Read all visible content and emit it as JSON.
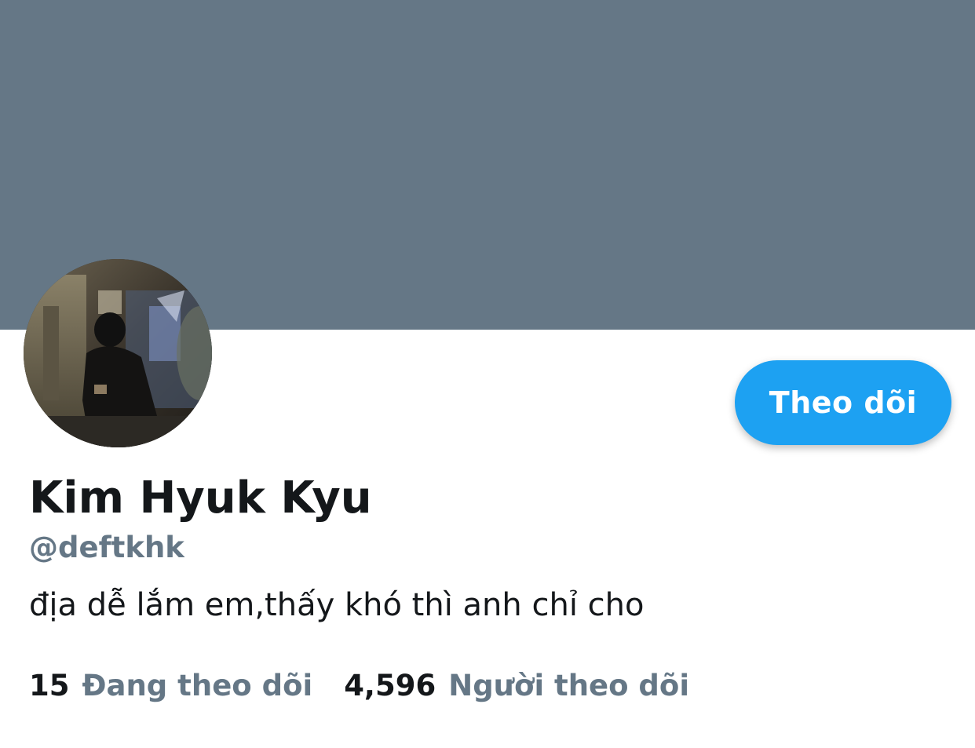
{
  "banner": {
    "color": "#657786"
  },
  "profile": {
    "display_name": "Kim Hyuk Kyu",
    "handle": "@deftkhk",
    "bio": "địa dễ lắm em,thấy khó thì anh chỉ cho"
  },
  "actions": {
    "follow_label": "Theo dõi",
    "accent": "#1da1f2"
  },
  "stats": {
    "following_count": "15",
    "following_label": "Đang theo dõi",
    "followers_count": "4,596",
    "followers_label": "Người theo dõi"
  },
  "colors": {
    "text": "#14171a",
    "muted": "#657786"
  }
}
